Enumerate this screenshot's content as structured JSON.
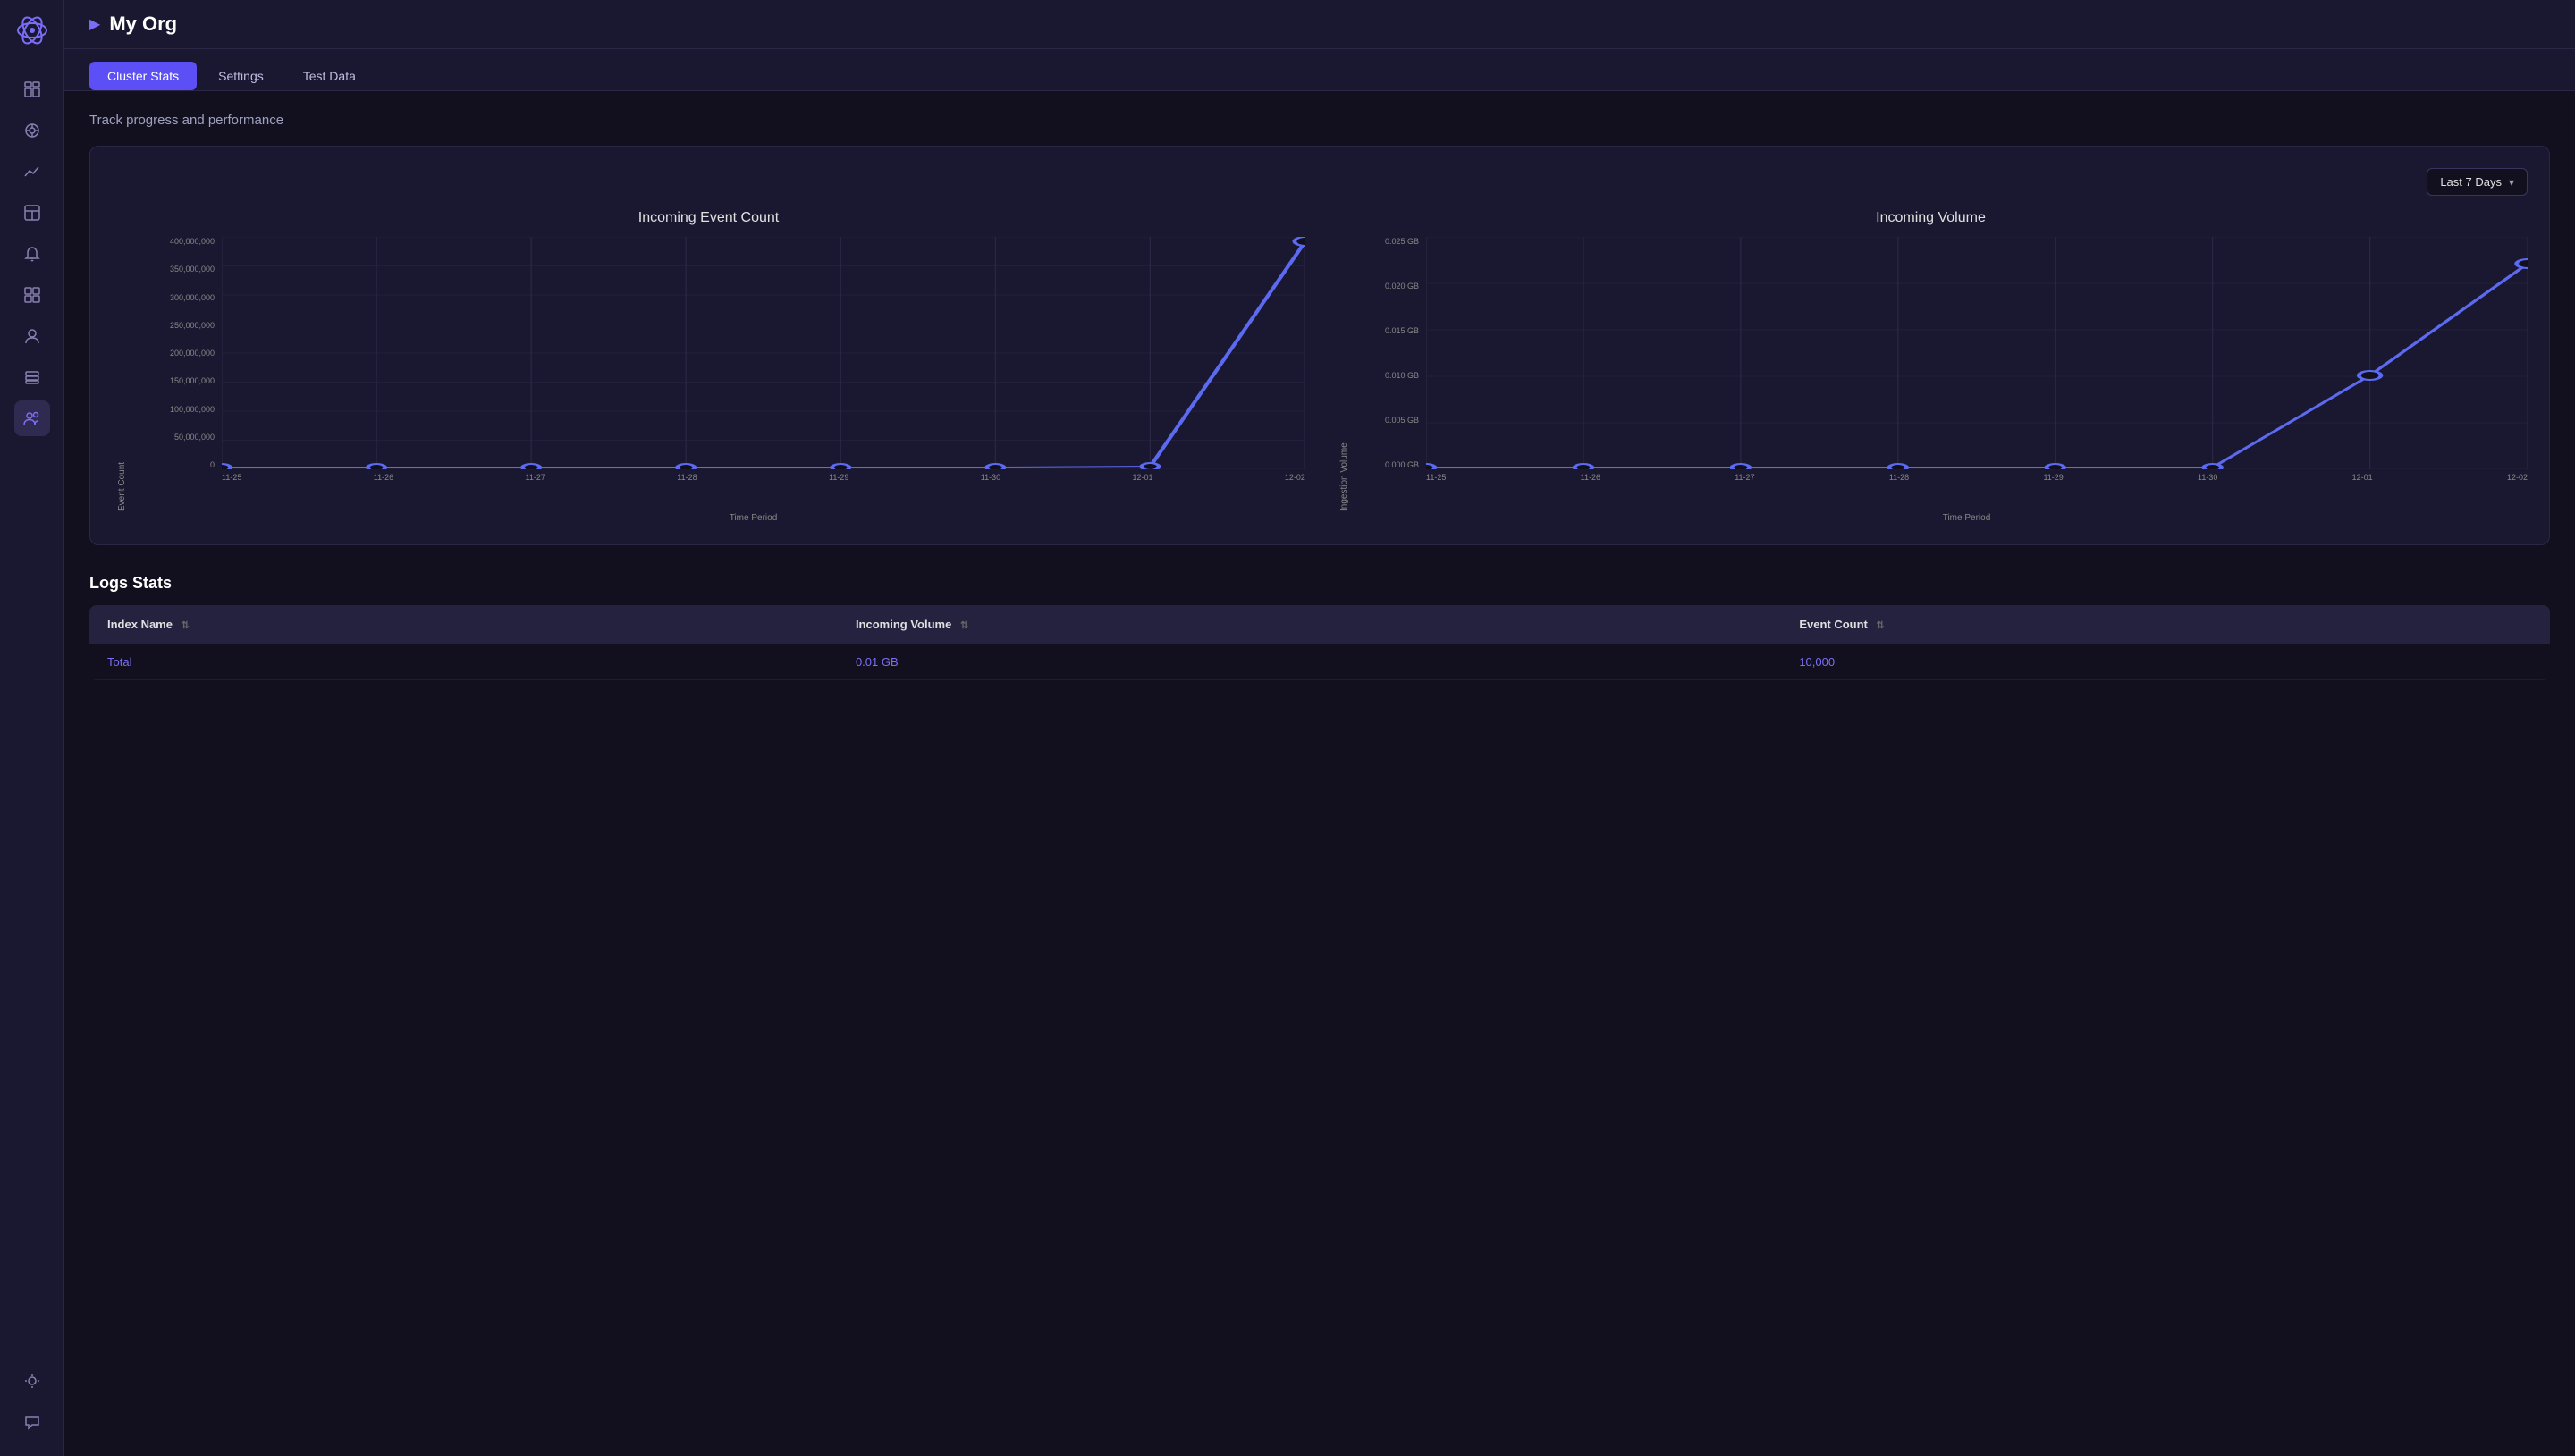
{
  "app": {
    "logo_alt": "Logo",
    "org_name": "My Org"
  },
  "sidebar": {
    "icons": [
      {
        "name": "dashboard-icon",
        "symbol": "⊞",
        "active": false
      },
      {
        "name": "network-icon",
        "symbol": "⬡",
        "active": false
      },
      {
        "name": "chart-icon",
        "symbol": "📈",
        "active": false
      },
      {
        "name": "layout-icon",
        "symbol": "▣",
        "active": false
      },
      {
        "name": "bell-icon",
        "symbol": "🔔",
        "active": false
      },
      {
        "name": "widgets-icon",
        "symbol": "⊞",
        "active": false
      },
      {
        "name": "person-icon",
        "symbol": "👤",
        "active": false
      },
      {
        "name": "storage-icon",
        "symbol": "🗄",
        "active": false
      },
      {
        "name": "users-icon",
        "symbol": "👥",
        "active": true
      }
    ],
    "bottom_icons": [
      {
        "name": "settings-icon",
        "symbol": "☀",
        "active": false
      },
      {
        "name": "chat-icon",
        "symbol": "💬",
        "active": false
      }
    ]
  },
  "header": {
    "arrow": "▶",
    "title": "My Org"
  },
  "tabs": [
    {
      "label": "Cluster Stats",
      "active": true
    },
    {
      "label": "Settings",
      "active": false
    },
    {
      "label": "Test Data",
      "active": false
    }
  ],
  "page_subtitle": "Track progress and performance",
  "date_filter": {
    "label": "Last 7 Days",
    "chevron": "▾"
  },
  "charts": {
    "incoming_event_count": {
      "title": "Incoming Event Count",
      "y_label": "Event Count",
      "x_label": "Time Period",
      "y_ticks": [
        "400,000,000",
        "350,000,000",
        "300,000,000",
        "250,000,000",
        "200,000,000",
        "150,000,000",
        "100,000,000",
        "50,000,000",
        "0"
      ],
      "x_ticks": [
        "11-25",
        "11-26",
        "11-27",
        "11-28",
        "11-29",
        "11-30",
        "12-01",
        "12-02"
      ],
      "data_points": [
        {
          "x": 0,
          "y": 0.001
        },
        {
          "x": 1,
          "y": 0.001
        },
        {
          "x": 2,
          "y": 0.001
        },
        {
          "x": 3,
          "y": 0.001
        },
        {
          "x": 4,
          "y": 0.001
        },
        {
          "x": 5,
          "y": 0.001
        },
        {
          "x": 6,
          "y": 0.005
        },
        {
          "x": 7,
          "y": 1.0
        }
      ]
    },
    "incoming_volume": {
      "title": "Incoming Volume",
      "y_label": "Ingestion Volume",
      "x_label": "Time Period",
      "y_ticks": [
        "0.025 GB",
        "0.020 GB",
        "0.015 GB",
        "0.010 GB",
        "0.005 GB",
        "0.000 GB"
      ],
      "x_ticks": [
        "11-25",
        "11-26",
        "11-27",
        "11-28",
        "11-29",
        "11-30",
        "12-01",
        "12-02"
      ],
      "data_points": [
        {
          "x": 0,
          "y": 0.0
        },
        {
          "x": 1,
          "y": 0.0
        },
        {
          "x": 2,
          "y": 0.0
        },
        {
          "x": 3,
          "y": 0.0
        },
        {
          "x": 4,
          "y": 0.0
        },
        {
          "x": 5,
          "y": 0.001
        },
        {
          "x": 6,
          "y": 0.42
        },
        {
          "x": 7,
          "y": 0.88
        }
      ]
    }
  },
  "logs_stats": {
    "title": "Logs Stats",
    "columns": [
      {
        "label": "Index Name",
        "sort": true
      },
      {
        "label": "Incoming Volume",
        "sort": true
      },
      {
        "label": "Event Count",
        "sort": true
      }
    ],
    "rows": [
      {
        "index_name": "Total",
        "incoming_volume": "0.01 GB",
        "event_count": "10,000"
      }
    ]
  }
}
